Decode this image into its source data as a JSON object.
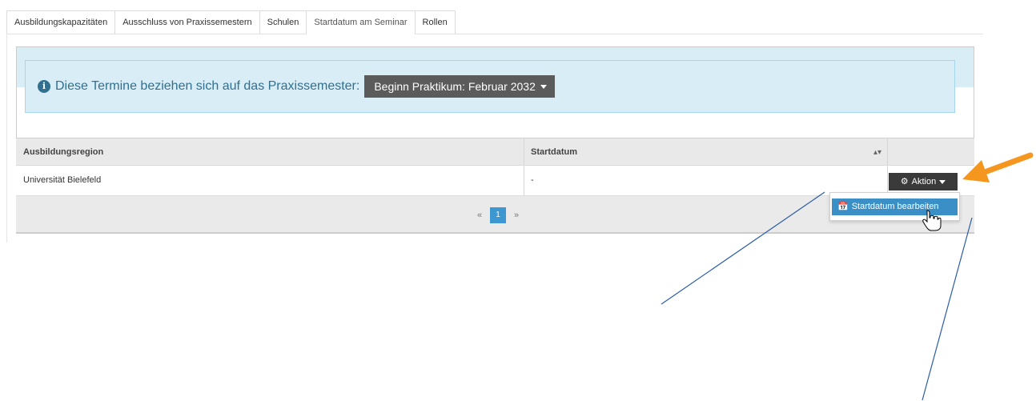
{
  "tabs": [
    {
      "label": "Ausbildungskapazitäten",
      "active": false
    },
    {
      "label": "Ausschluss von Praxissemestern",
      "active": false
    },
    {
      "label": "Schulen",
      "active": false
    },
    {
      "label": "Startdatum am Seminar",
      "active": true
    },
    {
      "label": "Rollen",
      "active": false
    }
  ],
  "info": {
    "icon": "info-circle-icon",
    "text": "Diese Termine beziehen sich auf das Praxissemester:",
    "semester_button": "Beginn Praktikum: Februar 2032"
  },
  "table": {
    "headers": {
      "region": "Ausbildungsregion",
      "startdate": "Startdatum"
    },
    "rows": [
      {
        "region": "Universität Bielefeld",
        "startdate": "-",
        "action": "Aktion"
      }
    ]
  },
  "pagination": {
    "prev": "«",
    "current": "1",
    "next": "»"
  },
  "dropdown": {
    "item": "Startdatum bearbeiten",
    "icon": "calendar-icon"
  },
  "colors": {
    "accent": "#3a8fc7",
    "info_bg": "#d9edf7",
    "arrow": "#f5961e",
    "annotation_line": "#2a5ca8"
  }
}
